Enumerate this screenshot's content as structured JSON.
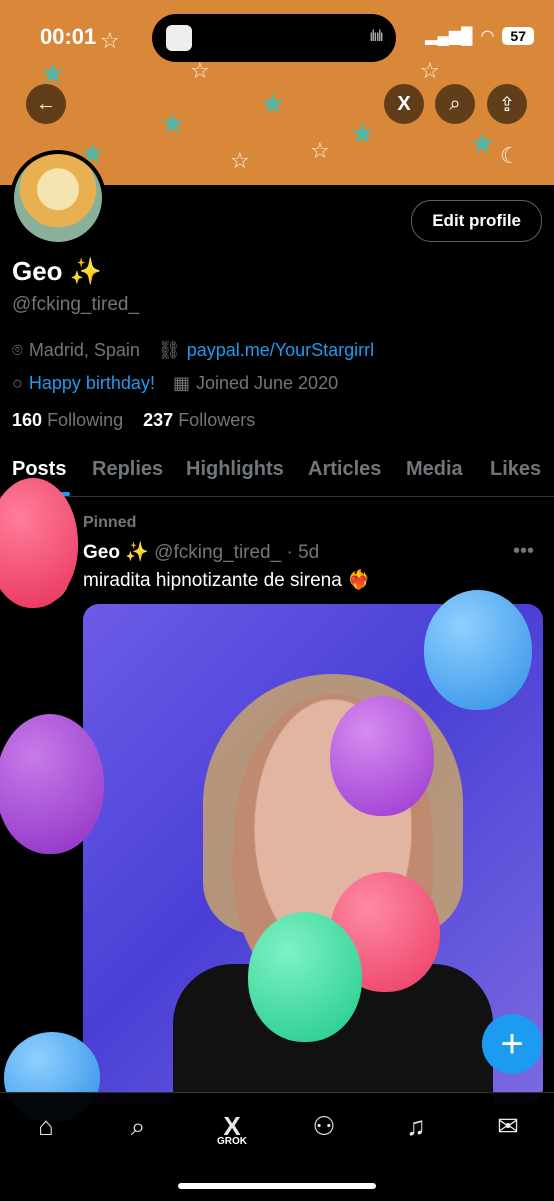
{
  "status": {
    "time": "00:01",
    "battery": "57"
  },
  "profile": {
    "name": "Geo ✨",
    "handle": "@fcking_tired_",
    "location": "Madrid, Spain",
    "website": "paypal.me/YourStargirrl",
    "birthday": "Happy birthday!",
    "joined": "Joined June 2020",
    "following_count": "160",
    "following_label": "Following",
    "followers_count": "237",
    "followers_label": "Followers",
    "edit_label": "Edit profile"
  },
  "tabs": [
    "Posts",
    "Replies",
    "Highlights",
    "Articles",
    "Media",
    "Likes"
  ],
  "post": {
    "pinned_label": "Pinned",
    "author": "Geo ✨",
    "handle_time": "@fcking_tired_ · 5d",
    "text": "miradita hipnotizante de sirena ❤️‍🔥"
  },
  "nav": {
    "grok_label": "GROK"
  },
  "colors": {
    "accent": "#1d9bf0",
    "banner": "#d9883a"
  }
}
